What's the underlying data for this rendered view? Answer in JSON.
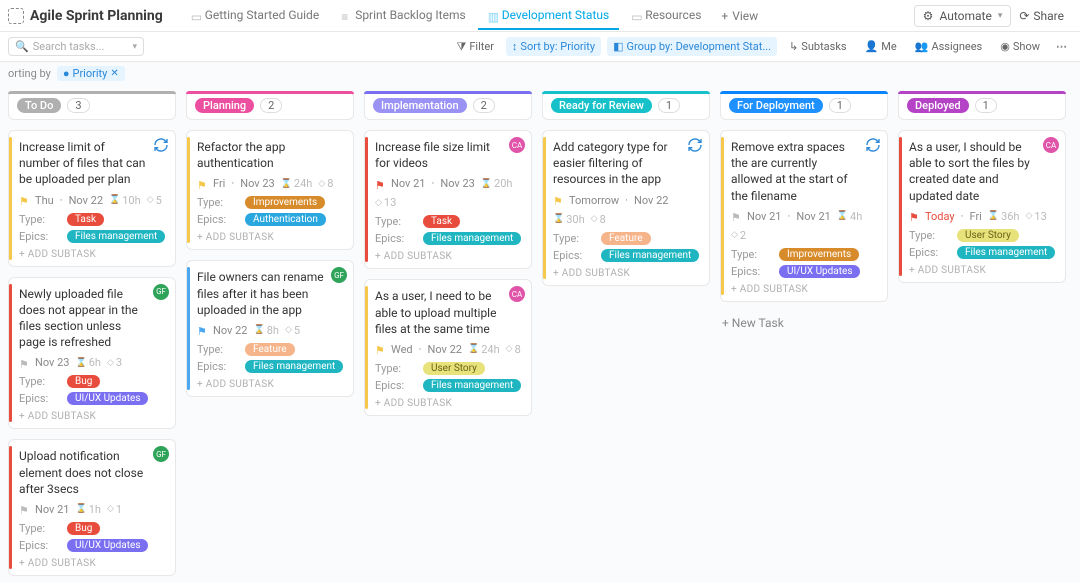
{
  "header": {
    "title": "Agile Sprint Planning",
    "tabs": [
      {
        "label": "Getting Started Guide"
      },
      {
        "label": "Sprint Backlog Items"
      },
      {
        "label": "Development Status"
      },
      {
        "label": "Resources"
      }
    ],
    "view_label": "View",
    "automate_label": "Automate",
    "share_label": "Share"
  },
  "toolbar": {
    "search_placeholder": "Search tasks...",
    "filter_label": "Filter",
    "sort_label": "Sort by: Priority",
    "group_label": "Group by: Development Stat...",
    "subtasks_label": "Subtasks",
    "me_label": "Me",
    "assignees_label": "Assignees",
    "show_label": "Show"
  },
  "sortbar": {
    "label": "orting by",
    "chip": "Priority"
  },
  "labels": {
    "type": "Type:",
    "epics": "Epics:",
    "add_subtask": "+ ADD SUBTASK",
    "new_task": "+ New Task"
  },
  "columns": [
    {
      "name": "To Do",
      "accent": "#b0b0b0",
      "pill_bg": "#b0b0b0",
      "count": "3",
      "cards": [
        {
          "title": "Increase limit of number of files that can be uploaded per plan",
          "priority_color": "#f5c84b",
          "sprint_icon": true,
          "meta": {
            "flag": "#f5c84b",
            "start": "Thu",
            "end": "Nov 22",
            "est": "10h",
            "points": "5"
          },
          "type": {
            "text": "Task",
            "cls": "red"
          },
          "epics": {
            "text": "Files management",
            "cls": "teal"
          }
        },
        {
          "title": "Newly uploaded file does not appear in the files section unless page is refreshed",
          "priority_color": "#e74c3c",
          "avatar": "green",
          "avatar_txt": "GF",
          "meta": {
            "flag": "",
            "start": "Nov 23",
            "est": "6h",
            "points": "3"
          },
          "type": {
            "text": "Bug",
            "cls": "red"
          },
          "epics": {
            "text": "UI/UX Updates",
            "cls": "purple"
          }
        },
        {
          "title": "Upload notification element does not close after 3secs",
          "priority_color": "#e74c3c",
          "avatar": "green",
          "avatar_txt": "GF",
          "meta": {
            "flag": "",
            "start": "Nov 21",
            "est": "1h",
            "points": "1"
          },
          "type": {
            "text": "Bug",
            "cls": "red"
          },
          "epics": {
            "text": "UI/UX Updates",
            "cls": "purple"
          }
        }
      ]
    },
    {
      "name": "Planning",
      "accent": "#ec4fa0",
      "pill_bg": "#ec4fa0",
      "count": "2",
      "cards": [
        {
          "title": "Refactor the app authentication",
          "priority_color": "#f5c84b",
          "meta": {
            "flag": "#f5c84b",
            "start": "Fri",
            "end": "Nov 23",
            "est": "24h",
            "points": "8"
          },
          "type": {
            "text": "Improvements",
            "cls": "orange"
          },
          "epics": {
            "text": "Authentication",
            "cls": "blue"
          }
        },
        {
          "title": "File owners can rename files after it has been uploaded in the app",
          "priority_color": "#4aa7f0",
          "avatar": "green",
          "avatar_txt": "GF",
          "meta": {
            "flag": "#4aa7f0",
            "start": "Nov 22",
            "est": "8h",
            "points": "5"
          },
          "type": {
            "text": "Feature",
            "cls": "peach"
          },
          "epics": {
            "text": "Files management",
            "cls": "teal"
          }
        }
      ]
    },
    {
      "name": "Implementation",
      "accent": "#7a6ff0",
      "pill_bg": "#9a92f5",
      "count": "2",
      "cards": [
        {
          "title": "Increase file size limit for videos",
          "priority_color": "#e74c3c",
          "avatar": "pink",
          "avatar_txt": "CA",
          "meta": {
            "flag": "#e74c3c",
            "start": "Nov 21",
            "end": "Nov 23",
            "est": "20h",
            "points": "13"
          },
          "type": {
            "text": "Task",
            "cls": "red"
          },
          "epics": {
            "text": "Files management",
            "cls": "teal"
          }
        },
        {
          "title": "As a user, I need to be able to upload multiple files at the same time",
          "priority_color": "#f5c84b",
          "avatar": "pink",
          "avatar_txt": "CA",
          "meta": {
            "flag": "#f5c84b",
            "start": "Wed",
            "end": "Nov 22",
            "est": "24h",
            "points": "8"
          },
          "type": {
            "text": "User Story",
            "cls": "yellow"
          },
          "epics": {
            "text": "Files management",
            "cls": "teal"
          }
        }
      ]
    },
    {
      "name": "Ready for Review",
      "accent": "#17c1c9",
      "pill_bg": "#17c1c9",
      "count": "1",
      "cards": [
        {
          "title": "Add category type for easier filtering of resources in the app",
          "priority_color": "#f5c84b",
          "sprint_icon": true,
          "meta": {
            "flag": "#f5c84b",
            "start": "Tomorrow",
            "end": "Nov 22",
            "est": "30h",
            "points": "8"
          },
          "type": {
            "text": "Feature",
            "cls": "peach"
          },
          "epics": {
            "text": "Files management",
            "cls": "teal"
          }
        }
      ]
    },
    {
      "name": "For Deployment",
      "accent": "#0a84ff",
      "pill_bg": "#1e90ff",
      "count": "1",
      "cards": [
        {
          "title": "Remove extra spaces the are currently allowed at the start of the filename",
          "priority_color": "#f5c84b",
          "sprint_icon": true,
          "meta": {
            "flag": "",
            "start": "Nov 21",
            "end": "Nov 21",
            "est": "4h",
            "points": "2"
          },
          "type": {
            "text": "Improvements",
            "cls": "orange"
          },
          "epics": {
            "text": "UI/UX Updates",
            "cls": "purple"
          }
        }
      ],
      "show_new_task": true
    },
    {
      "name": "Deployed",
      "accent": "#b543c6",
      "pill_bg": "#b543c6",
      "count": "1",
      "cards": [
        {
          "title": "As a user, I should be able to sort the files by created date and updated date",
          "priority_color": "#e74c3c",
          "avatar": "pink",
          "avatar_txt": "CA",
          "meta": {
            "flag": "#e74c3c",
            "start": "Today",
            "start_red": true,
            "end": "Fri",
            "est": "36h",
            "points": "13"
          },
          "type": {
            "text": "User Story",
            "cls": "yellow"
          },
          "epics": {
            "text": "Files management",
            "cls": "teal"
          }
        }
      ]
    }
  ]
}
